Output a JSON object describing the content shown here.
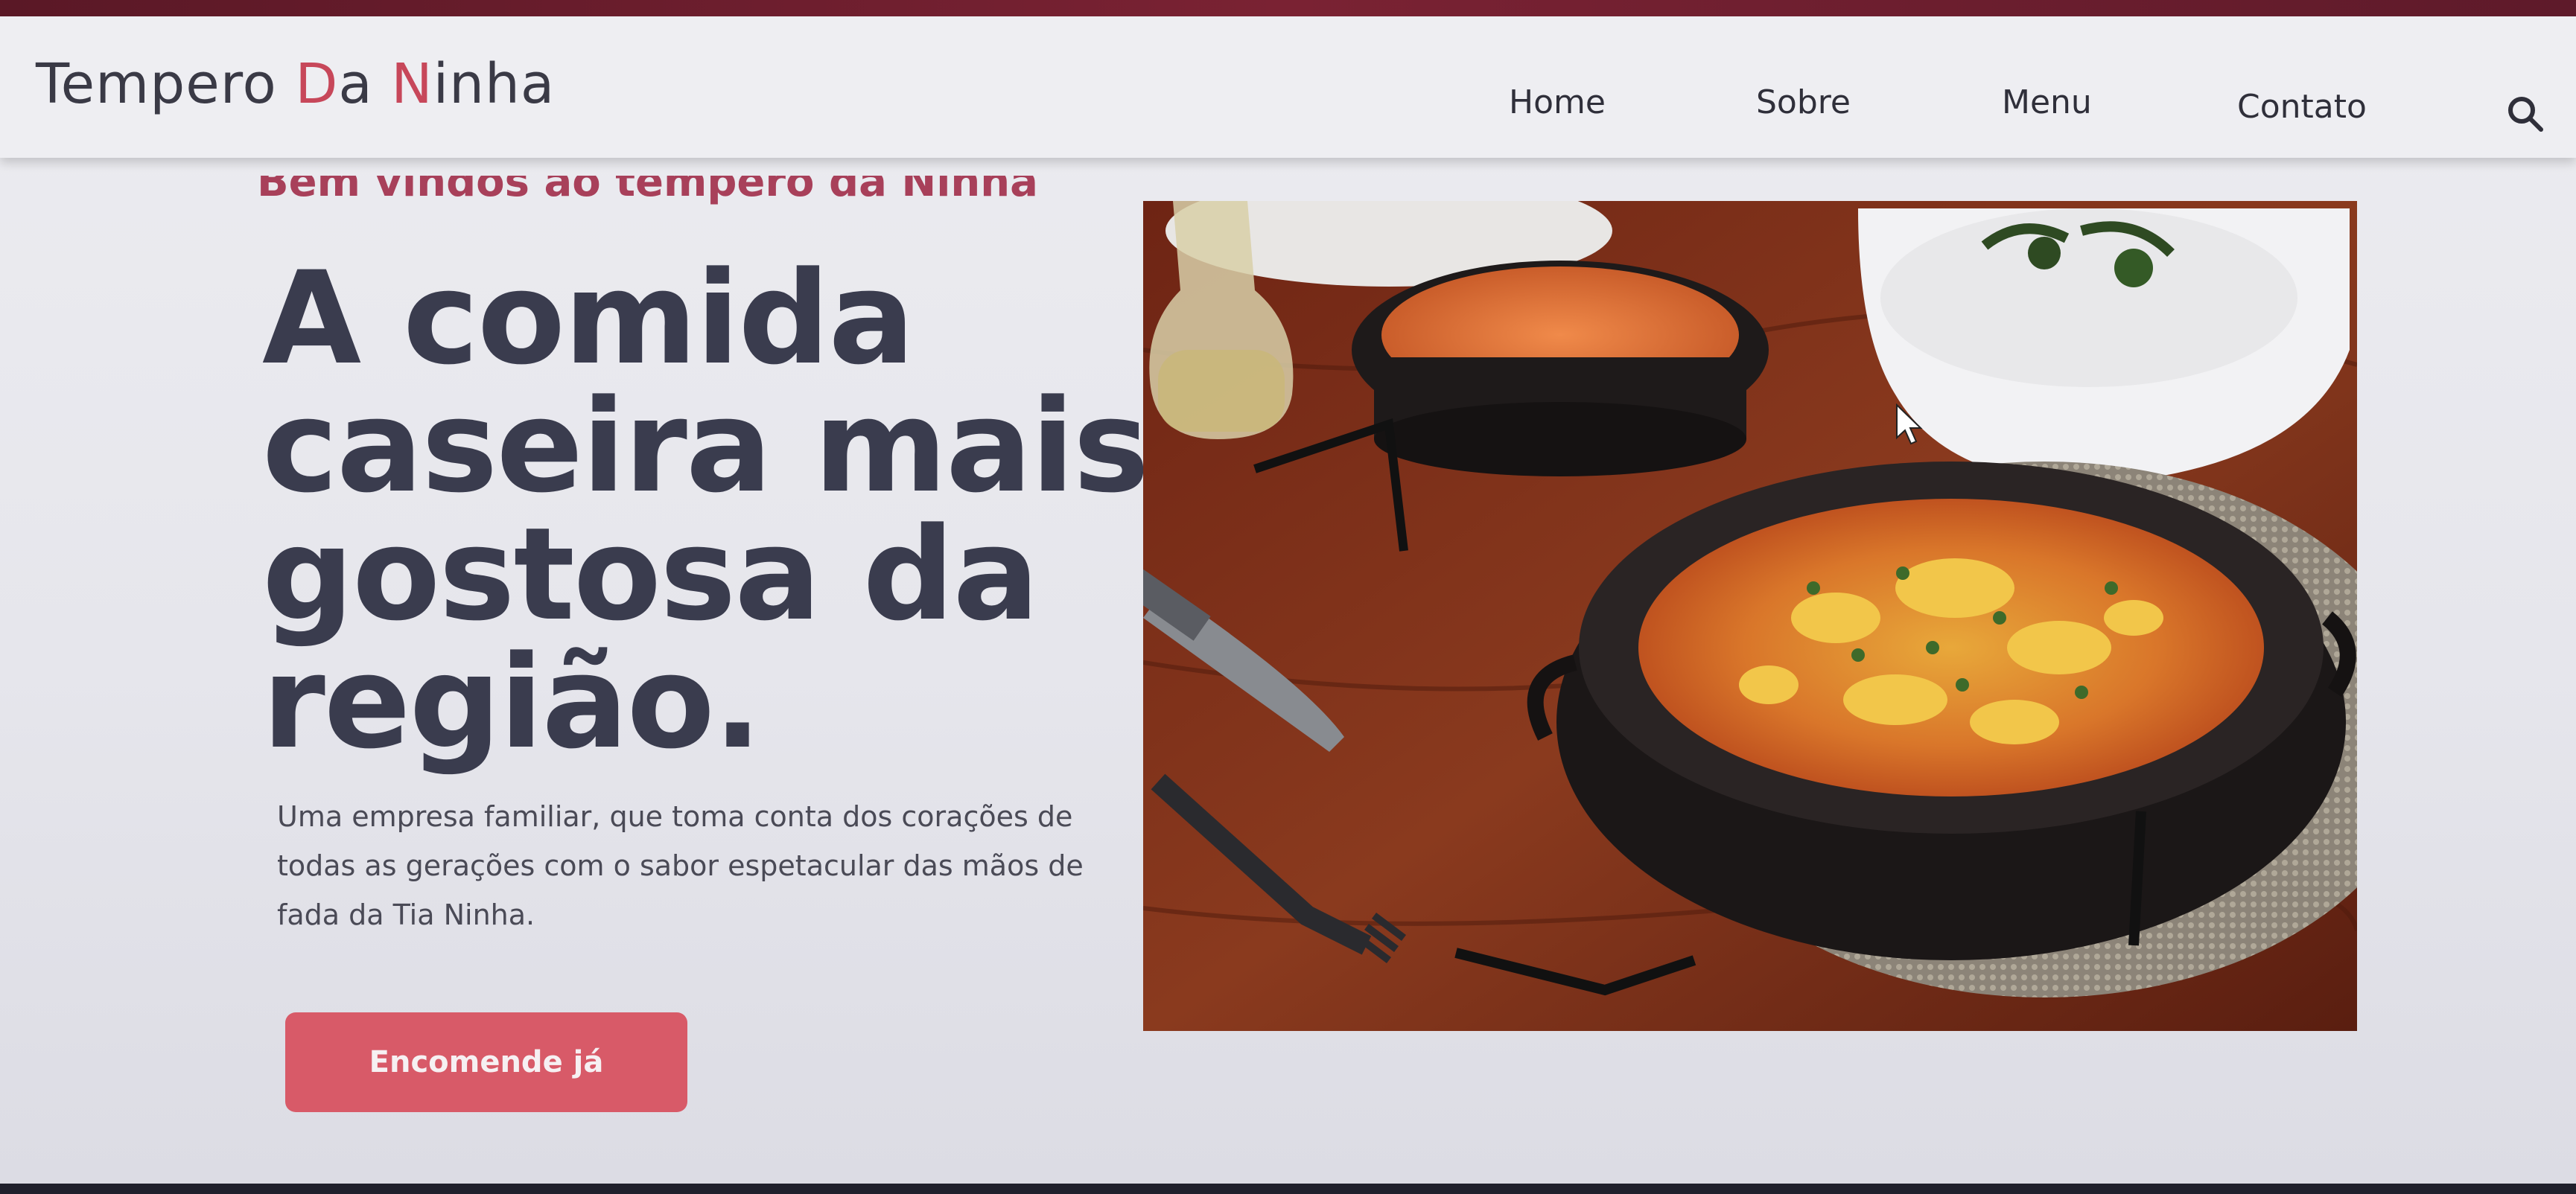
{
  "brand": {
    "part1": "Tempero ",
    "part2": "D",
    "part3": "a ",
    "part4": "N",
    "part5": "inha"
  },
  "nav": {
    "items": [
      {
        "label": "Home"
      },
      {
        "label": "Sobre"
      },
      {
        "label": "Menu"
      },
      {
        "label": "Contato"
      }
    ]
  },
  "hero": {
    "eyebrow": "Bem vindos ao tempero da Ninha",
    "headline": "A comida caseira mais gostosa da região.",
    "description": "Uma empresa familiar, que toma conta dos corações de todas as gerações com o sabor espetacular das mãos de fada da Tia Ninha.",
    "cta_label": "Encomende já"
  },
  "icons": {
    "search": "search-icon",
    "cursor": "mouse-cursor-icon"
  },
  "colors": {
    "accent": "#c7475a",
    "cta": "#d85a68",
    "headline": "#3a3c4e"
  }
}
